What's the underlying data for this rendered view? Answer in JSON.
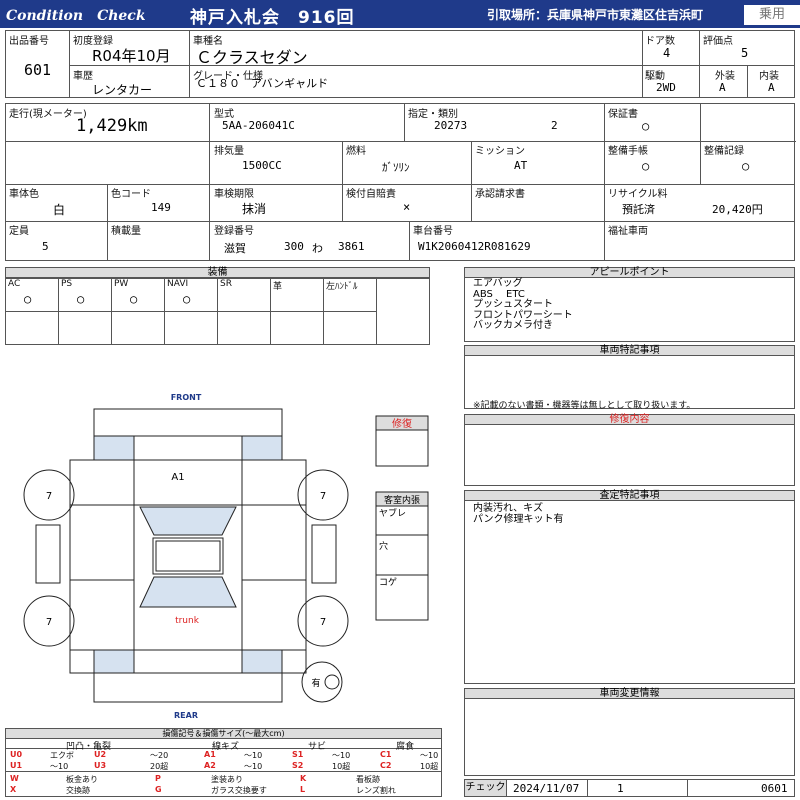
{
  "header": {
    "title": "Condition　Check",
    "auction": "神戸入札会　916回",
    "pickup": "引取場所：兵庫県神戸市東灘区住吉浜町",
    "category": "乗用"
  },
  "top": {
    "lot_label": "出品番号",
    "lot": "601",
    "first_reg_label": "初度登録",
    "first_reg": "R04年10月",
    "model_label": "車種名",
    "model": "Ｃクラスセダン",
    "doors_label": "ドア数",
    "doors": "4",
    "score_label": "評価点",
    "score": "5",
    "history_label": "車歴",
    "history": "レンタカー",
    "grade_label": "グレード・仕様",
    "grade": "Ｃ１８０　アバンギャルド",
    "drive_label": "駆動",
    "drive": "2WD",
    "ext_label": "外装",
    "ext": "A",
    "int_label": "内装",
    "int": "A"
  },
  "spec": {
    "mileage_label": "走行(現メーター)",
    "mileage": "1,429km",
    "type_label": "型式",
    "type": "5AA-206041C",
    "designation_label": "指定・類別",
    "designation": "20273",
    "category_no": "2",
    "warranty_label": "保証書",
    "warranty": "○",
    "displacement_label": "排気量",
    "displacement": "1500CC",
    "fuel_label": "燃料",
    "fuel": "ｶﾞｿﾘﾝ",
    "mission_label": "ミッション",
    "mission": "AT",
    "manual_label": "整備手帳",
    "manual": "○",
    "record_label": "整備記録",
    "record": "○",
    "color_label": "車体色",
    "color": "白",
    "color_code_label": "色コード",
    "color_code": "149",
    "inspection_label": "車検期限",
    "inspection": "抹消",
    "insurance_label": "検付自賠責",
    "insurance": "×",
    "approval_label": "承認請求書",
    "recycle_label": "リサイクル料",
    "recycle_status": "預託済",
    "recycle_fee": "20,420円",
    "capacity_label": "定員",
    "capacity": "5",
    "load_label": "積載量",
    "plate_label": "登録番号",
    "plate_pref": "滋賀",
    "plate_class": "300",
    "plate_kana": "わ",
    "plate_no": "3861",
    "chassis_label": "車台番号",
    "chassis": "W1K2060412R081629",
    "welfare_label": "福祉車両"
  },
  "equipment": {
    "title": "装備",
    "cols": [
      {
        "label": "AC",
        "value": "○"
      },
      {
        "label": "PS",
        "value": "○"
      },
      {
        "label": "PW",
        "value": "○"
      },
      {
        "label": "NAVI",
        "value": "○"
      },
      {
        "label": "SR",
        "value": ""
      },
      {
        "label": "革",
        "value": ""
      },
      {
        "label": "左ﾊﾝﾄﾞﾙ",
        "value": ""
      }
    ]
  },
  "appeal": {
    "title": "アピールポイント",
    "lines": [
      "エアバッグ",
      "ABS　 ETC",
      "プッシュスタート",
      "フロントパワーシート",
      "バックカメラ付き"
    ]
  },
  "special": {
    "title": "車両特記事項",
    "note": "※記載のない書類・機器等は無しとして取り扱います。"
  },
  "repair": {
    "title": "修復内容"
  },
  "assess": {
    "title": "査定特記事項",
    "lines": [
      "内装汚れ、キズ",
      "パンク修理キット有"
    ]
  },
  "change": {
    "title": "車両変更情報"
  },
  "diagram": {
    "front": "FRONT",
    "rear": "REAR",
    "trunk": "trunk",
    "a1": "A1",
    "tire_fl": "7",
    "tire_fr": "7",
    "tire_rl": "7",
    "tire_rr": "7",
    "spare": "有",
    "repair_label": "修復",
    "interior_label": "客室内張",
    "yabure": "ヤブレ",
    "ana": "穴",
    "koge": "コゲ"
  },
  "legend": {
    "title": "損傷記号＆損傷サイズ(〜最大cm)",
    "h1": "凹凸・亀裂",
    "h2": "線キズ",
    "h3": "サビ",
    "h4": "腐食",
    "r1": [
      [
        "U0",
        "エクボ"
      ],
      [
        "U2",
        "〜20"
      ],
      [
        "A1",
        "〜10"
      ],
      [
        "S1",
        "〜10"
      ],
      [
        "C1",
        "〜10"
      ]
    ],
    "r2": [
      [
        "U1",
        "〜10"
      ],
      [
        "U3",
        "20超"
      ],
      [
        "A2",
        "〜10"
      ],
      [
        "S2",
        "10超"
      ],
      [
        "C2",
        "10超"
      ]
    ],
    "r3": [
      [
        "W",
        "板金あり"
      ],
      [
        "P",
        "塗装あり"
      ],
      [
        "K",
        "看板跡"
      ]
    ],
    "r4": [
      [
        "X",
        "交換跡"
      ],
      [
        "G",
        "ガラス交換要す"
      ],
      [
        "L",
        "レンズ割れ"
      ]
    ]
  },
  "check": {
    "label": "チェック",
    "date": "2024/11/07",
    "num": "1",
    "code": "0601"
  }
}
